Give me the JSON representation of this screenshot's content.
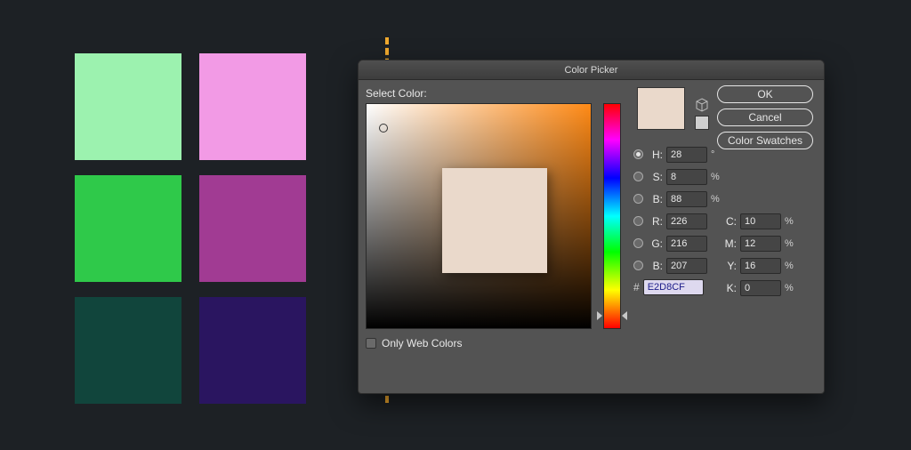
{
  "swatches": [
    "#9cf2af",
    "#f29ae5",
    "#2fc94a",
    "#a13b93",
    "#11453c",
    "#2a1560"
  ],
  "dialog": {
    "title": "Color Picker",
    "select_label": "Select Color:",
    "only_web_colors": "Only Web Colors",
    "buttons": {
      "ok": "OK",
      "cancel": "Cancel",
      "swatches": "Color Swatches"
    },
    "hsb": {
      "h_label": "H:",
      "h_value": "28",
      "deg": "°",
      "s_label": "S:",
      "s_value": "8",
      "pct": "%",
      "b_label": "B:",
      "b_value": "88"
    },
    "rgb": {
      "r_label": "R:",
      "r_value": "226",
      "g_label": "G:",
      "g_value": "216",
      "b_label": "B:",
      "b_value": "207"
    },
    "cmyk": {
      "c_label": "C:",
      "c_value": "10",
      "m_label": "M:",
      "m_value": "12",
      "y_label": "Y:",
      "y_value": "16",
      "k_label": "K:",
      "k_value": "0",
      "pct": "%"
    },
    "hex": {
      "hash": "#",
      "value": "E2D8CF"
    },
    "preview_color": "#ead9cb",
    "hue_base": "#ff8a16"
  }
}
